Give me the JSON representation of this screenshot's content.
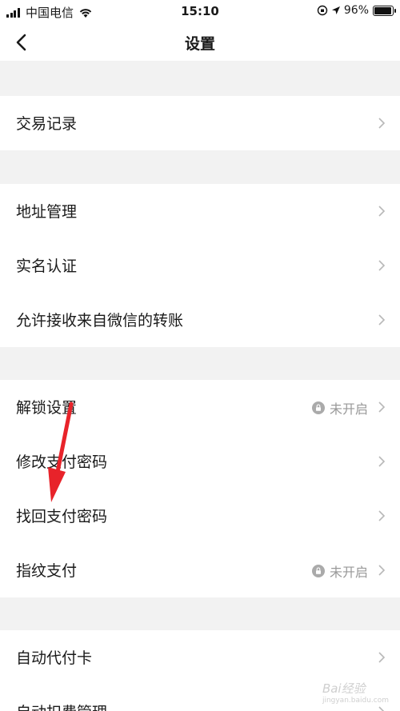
{
  "status_bar": {
    "carrier": "中国电信",
    "time": "15:10",
    "battery": "96%",
    "battery_level": 0.96
  },
  "nav": {
    "title": "设置"
  },
  "groups": [
    {
      "items": [
        {
          "label": "交易记录"
        }
      ]
    },
    {
      "items": [
        {
          "label": "地址管理"
        },
        {
          "label": "实名认证"
        },
        {
          "label": "允许接收来自微信的转账"
        }
      ]
    },
    {
      "items": [
        {
          "label": "解锁设置",
          "status": "未开启",
          "status_icon": "lock-icon"
        },
        {
          "label": "修改支付密码"
        },
        {
          "label": "找回支付密码"
        },
        {
          "label": "指纹支付",
          "status": "未开启",
          "status_icon": "lock-icon"
        }
      ]
    },
    {
      "items": [
        {
          "label": "自动代付卡"
        },
        {
          "label": "自动扣费管理"
        }
      ]
    }
  ],
  "annotation": {
    "arrow_color": "#e8232a"
  },
  "watermark": {
    "text": "Bai经验",
    "sub": "jingyan.baidu.com"
  },
  "colors": {
    "background": "#f2f2f2",
    "row_text": "#1a1a1a",
    "secondary_text": "#999999"
  }
}
